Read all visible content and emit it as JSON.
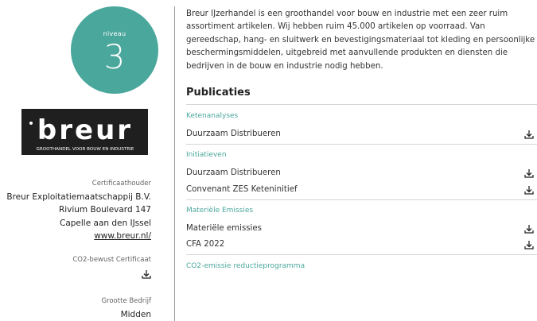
{
  "level_badge": {
    "label": "niveau",
    "value": "3",
    "color": "#4aa79c"
  },
  "logo": {
    "brand": "breur",
    "tagline": "GROOTHANDEL VOOR BOUW EN INDUSTRIE"
  },
  "certificate_holder": {
    "caption": "Certificaathouder",
    "name": "Breur Exploitatiemaatschappij B.V.",
    "address": "Rivium Boulevard 147",
    "city": "Capelle aan den IJssel",
    "website": "www.breur.nl/"
  },
  "co2_certificate": {
    "caption": "CO2-bewust Certificaat",
    "icon": "download-icon"
  },
  "company_size": {
    "caption": "Grootte Bedrijf",
    "value": "Midden"
  },
  "intro": {
    "lines": [
      "Breur IJzerhandel is een groothandel voor bouw en industrie met een zeer ruim",
      "assortiment artikelen. Wij hebben ruim 45.000 artikelen op voorraad. Van",
      "gereedschap, hang- en sluitwerk en bevestigingsmateriaal tot kleding en persoonlijke",
      "beschermingsmiddelen, uitgebreid met aanvullende produkten en diensten die",
      "bedrijven in de bouw en industrie nodig hebben."
    ]
  },
  "publications": {
    "title": "Publicaties",
    "categories": [
      {
        "name": "Ketenanalyses",
        "items": [
          "Duurzaam Distribueren"
        ]
      },
      {
        "name": "Initiatieven",
        "items": [
          "Duurzaam Distribueren",
          "Convenant ZES Keteninitief"
        ]
      },
      {
        "name": "Materiële Emissies",
        "items": [
          "Materiële emissies",
          "CFA 2022"
        ]
      },
      {
        "name": "CO2-emissie reductieprogramma",
        "items": []
      }
    ]
  },
  "colors": {
    "accent": "#4aa79c",
    "logo_bg": "#1f1f1f"
  }
}
